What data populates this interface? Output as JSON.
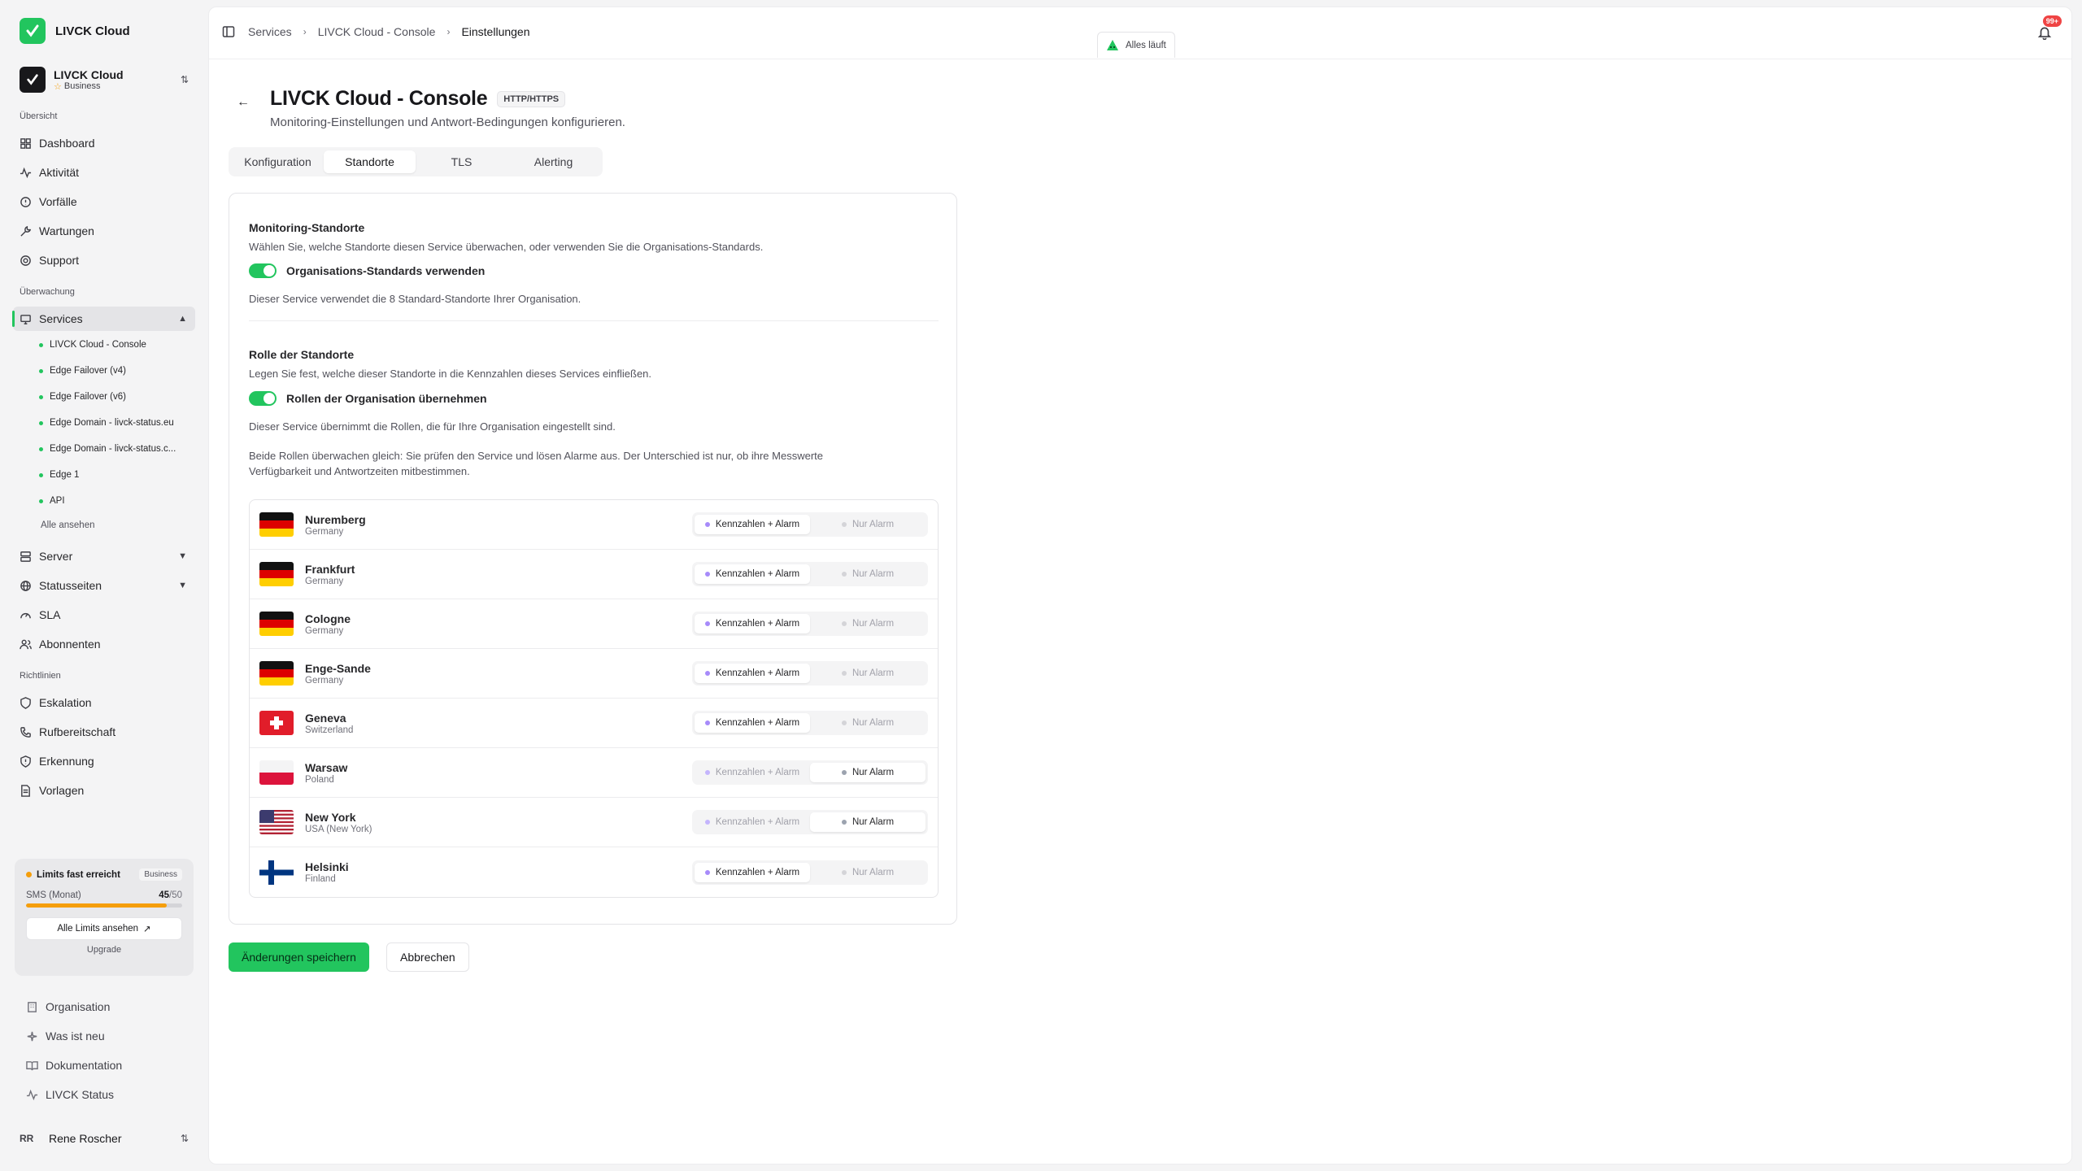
{
  "brand": {
    "name": "LIVCK Cloud"
  },
  "org": {
    "name": "LIVCK Cloud",
    "plan": "Business"
  },
  "sidebar": {
    "section_overview": "Übersicht",
    "overview": [
      "Dashboard",
      "Aktivität",
      "Vorfälle",
      "Wartungen",
      "Support"
    ],
    "section_monitoring": "Überwachung",
    "services_label": "Services",
    "services": [
      "LIVCK Cloud - Console",
      "Edge Failover (v4)",
      "Edge Failover (v6)",
      "Edge Domain - livck-status.eu",
      "Edge Domain - livck-status.c...",
      "Edge 1",
      "API"
    ],
    "services_all": "Alle ansehen",
    "monitoring_more": [
      "Server",
      "Statusseiten",
      "SLA",
      "Abonnenten"
    ],
    "section_policies": "Richtlinien",
    "policies": [
      "Eskalation",
      "Rufbereitschaft",
      "Erkennung",
      "Vorlagen"
    ],
    "footer": [
      "Organisation",
      "Was ist neu",
      "Dokumentation",
      "LIVCK Status"
    ]
  },
  "limits": {
    "title": "Limits fast erreicht",
    "badge": "Business",
    "label": "SMS (Monat)",
    "used": "45",
    "total": "/50",
    "fraction": 0.9,
    "button": "Alle Limits ansehen",
    "upgrade": "Upgrade"
  },
  "user": {
    "initials": "RR",
    "name": "Rene Roscher"
  },
  "topbar": {
    "crumbs": [
      "Services",
      "LIVCK Cloud - Console",
      "Einstellungen"
    ],
    "status": "Alles läuft",
    "notifications": "99+"
  },
  "page": {
    "title": "LIVCK Cloud - Console",
    "protocol": "HTTP/HTTPS",
    "subtitle": "Monitoring-Einstellungen und Antwort-Bedingungen konfigurieren."
  },
  "tabs": [
    "Konfiguration",
    "Standorte",
    "TLS",
    "Alerting"
  ],
  "card": {
    "loc_title": "Monitoring-Standorte",
    "loc_desc": "Wählen Sie, welche Standorte diesen Service überwachen, oder verwenden Sie die Organisations-Standards.",
    "loc_toggle": "Organisations-Standards verwenden",
    "loc_note": "Dieser Service verwendet die 8 Standard-Standorte Ihrer Organisation.",
    "role_title": "Rolle der Standorte",
    "role_desc": "Legen Sie fest, welche dieser Standorte in die Kennzahlen dieses Services einfließen.",
    "role_toggle": "Rollen der Organisation übernehmen",
    "role_note": "Dieser Service übernimmt die Rollen, die für Ihre Organisation eingestellt sind.",
    "role_info_1": "Beide Rollen überwachen gleich: Sie prüfen den Service und lösen Alarme aus. Der Unterschied ist nur, ob ihre Messwerte",
    "role_info_2": "Verfügbarkeit und Antwortzeiten mitbestimmen.",
    "opt_metrics": "Kennzahlen + Alarm",
    "opt_alarm": "Nur Alarm"
  },
  "locations": [
    {
      "city": "Nuremberg",
      "country": "Germany",
      "flag": "de",
      "role": "metrics"
    },
    {
      "city": "Frankfurt",
      "country": "Germany",
      "flag": "de",
      "role": "metrics"
    },
    {
      "city": "Cologne",
      "country": "Germany",
      "flag": "de",
      "role": "metrics"
    },
    {
      "city": "Enge-Sande",
      "country": "Germany",
      "flag": "de",
      "role": "metrics"
    },
    {
      "city": "Geneva",
      "country": "Switzerland",
      "flag": "ch",
      "role": "metrics"
    },
    {
      "city": "Warsaw",
      "country": "Poland",
      "flag": "pl",
      "role": "alarm"
    },
    {
      "city": "New York",
      "country": "USA (New York)",
      "flag": "us",
      "role": "alarm"
    },
    {
      "city": "Helsinki",
      "country": "Finland",
      "flag": "fi",
      "role": "metrics"
    }
  ],
  "actions": {
    "save": "Änderungen speichern",
    "cancel": "Abbrechen"
  },
  "colors": {
    "accent": "#22c55e",
    "warning": "#f59e0b",
    "badge": "#ef4444"
  }
}
